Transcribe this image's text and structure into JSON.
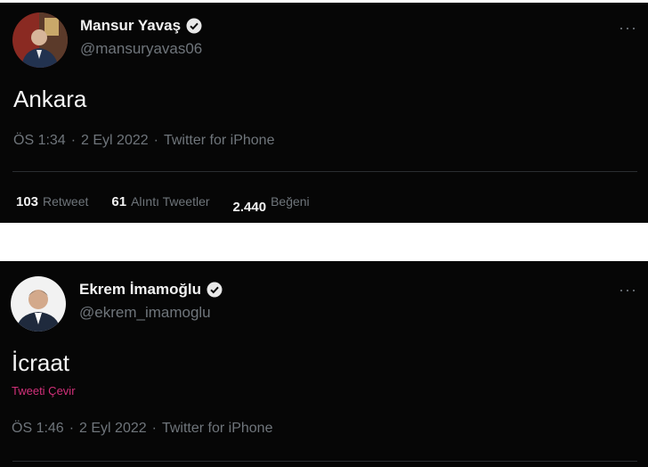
{
  "tweets": [
    {
      "display_name": "Mansur Yavaş",
      "handle": "@mansuryavas06",
      "text": "Ankara",
      "time": "ÖS 1:34",
      "date": "2 Eyl 2022",
      "source": "Twitter for iPhone",
      "more": "···",
      "stats": {
        "retweets": "103",
        "retweets_label": "Retweet",
        "quotes": "61",
        "quotes_label": "Alıntı Tweetler",
        "likes": "2.440",
        "likes_label": "Beğeni"
      }
    },
    {
      "display_name": "Ekrem İmamoğlu",
      "handle": "@ekrem_imamoglu",
      "text": "İcraat",
      "translate": "Tweeti Çevir",
      "time": "ÖS 1:46",
      "date": "2 Eyl 2022",
      "source": "Twitter for iPhone",
      "more": "···"
    }
  ],
  "separator": "·",
  "colors": {
    "background": "#060606",
    "name": "#f2f2f2",
    "muted": "#6f757b",
    "translate": "#d2307a",
    "verified": "#e8e8e8"
  },
  "icons": {
    "verified": "verified-badge-icon",
    "more": "more-options-icon"
  }
}
